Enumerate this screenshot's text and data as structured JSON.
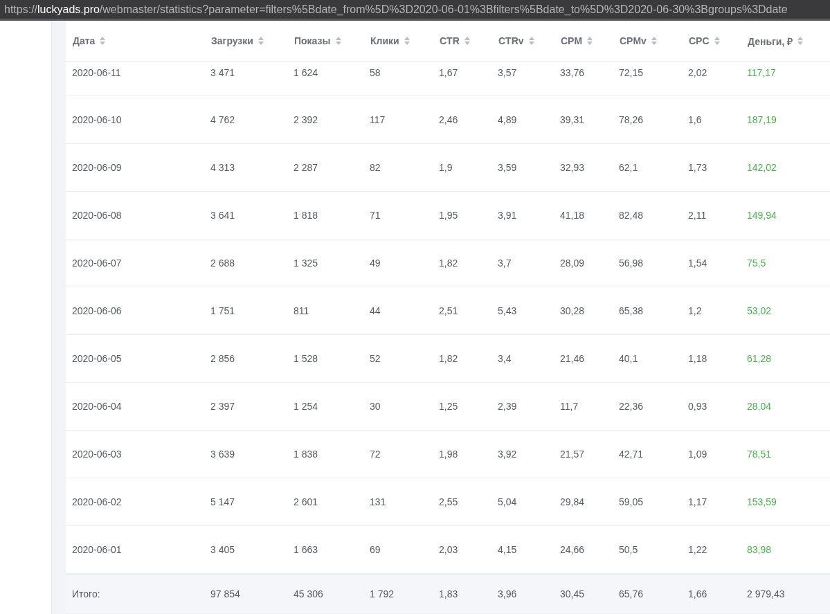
{
  "address_bar": {
    "prefix": "https://",
    "domain": "luckyads.pro",
    "path": "/webmaster/statistics?parameter=filters%5Bdate_from%5D%3D2020-06-01%3Bfilters%5Bdate_to%5D%3D2020-06-30%3Bgroups%3Ddate"
  },
  "table": {
    "columns": [
      "Дата",
      "Загрузки",
      "Показы",
      "Клики",
      "CTR",
      "CTRv",
      "CPM",
      "CPMv",
      "CPC",
      "Деньги, ₽"
    ],
    "rows": [
      [
        "2020-06-11",
        "3 471",
        "1 624",
        "58",
        "1,67",
        "3,57",
        "33,76",
        "72,15",
        "2,02",
        "117,17"
      ],
      [
        "2020-06-10",
        "4 762",
        "2 392",
        "117",
        "2,46",
        "4,89",
        "39,31",
        "78,26",
        "1,6",
        "187,19"
      ],
      [
        "2020-06-09",
        "4 313",
        "2 287",
        "82",
        "1,9",
        "3,59",
        "32,93",
        "62,1",
        "1,73",
        "142,02"
      ],
      [
        "2020-06-08",
        "3 641",
        "1 818",
        "71",
        "1,95",
        "3,91",
        "41,18",
        "82,48",
        "2,11",
        "149,94"
      ],
      [
        "2020-06-07",
        "2 688",
        "1 325",
        "49",
        "1,82",
        "3,7",
        "28,09",
        "56,98",
        "1,54",
        "75,5"
      ],
      [
        "2020-06-06",
        "1 751",
        "811",
        "44",
        "2,51",
        "5,43",
        "30,28",
        "65,38",
        "1,2",
        "53,02"
      ],
      [
        "2020-06-05",
        "2 856",
        "1 528",
        "52",
        "1,82",
        "3,4",
        "21,46",
        "40,1",
        "1,18",
        "61,28"
      ],
      [
        "2020-06-04",
        "2 397",
        "1 254",
        "30",
        "1,25",
        "2,39",
        "11,7",
        "22,36",
        "0,93",
        "28,04"
      ],
      [
        "2020-06-03",
        "3 639",
        "1 838",
        "72",
        "1,98",
        "3,92",
        "21,57",
        "42,71",
        "1,09",
        "78,51"
      ],
      [
        "2020-06-02",
        "5 147",
        "2 601",
        "131",
        "2,55",
        "5,04",
        "29,84",
        "59,05",
        "1,17",
        "153,59"
      ],
      [
        "2020-06-01",
        "3 405",
        "1 663",
        "69",
        "2,03",
        "4,15",
        "24,66",
        "50,5",
        "1,22",
        "83,98"
      ]
    ],
    "total": [
      "Итого:",
      "97 854",
      "45 306",
      "1 792",
      "1,83",
      "3,96",
      "30,45",
      "65,76",
      "1,66",
      "2 979,43"
    ]
  }
}
